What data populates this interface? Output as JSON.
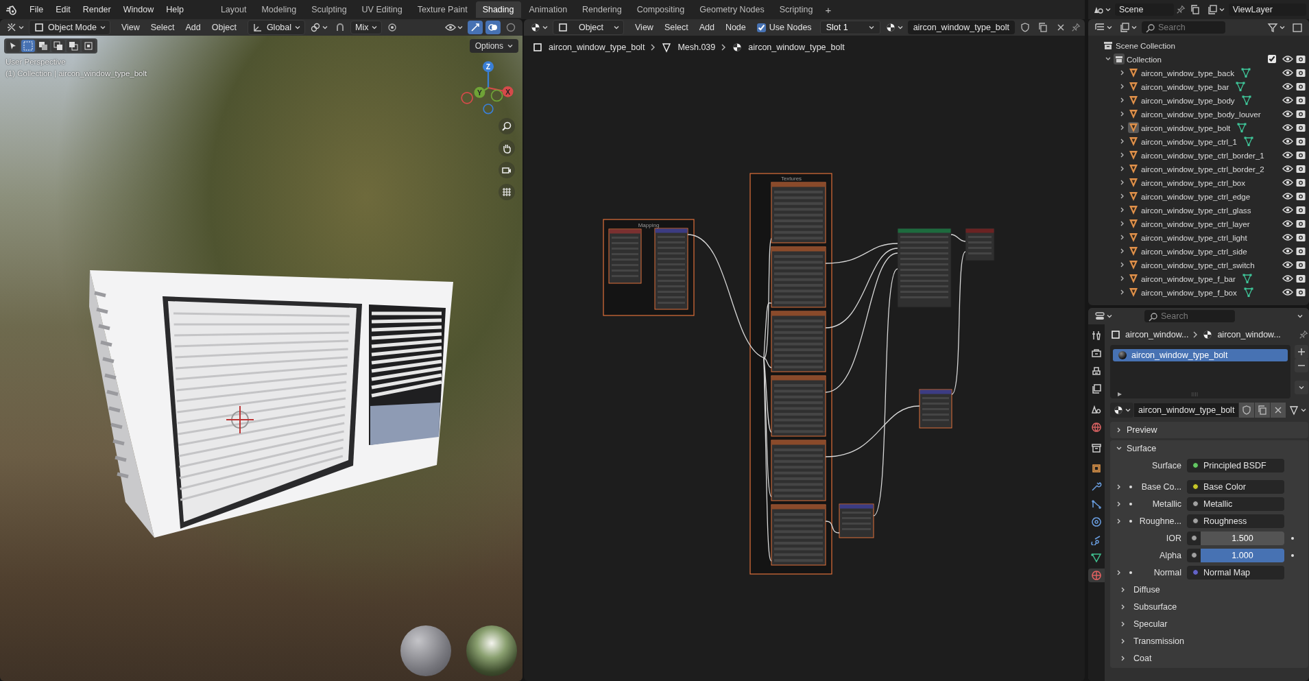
{
  "top_bar": {
    "menus": [
      "File",
      "Edit",
      "Render",
      "Window",
      "Help"
    ],
    "workspaces": [
      {
        "label": "Layout",
        "selected": false
      },
      {
        "label": "Modeling",
        "selected": false
      },
      {
        "label": "Sculpting",
        "selected": false
      },
      {
        "label": "UV Editing",
        "selected": false
      },
      {
        "label": "Texture Paint",
        "selected": false
      },
      {
        "label": "Shading",
        "selected": true
      },
      {
        "label": "Animation",
        "selected": false
      },
      {
        "label": "Rendering",
        "selected": false
      },
      {
        "label": "Compositing",
        "selected": false
      },
      {
        "label": "Geometry Nodes",
        "selected": false
      },
      {
        "label": "Scripting",
        "selected": false
      }
    ],
    "add_tab": "+"
  },
  "scene_bar": {
    "scene": "Scene",
    "view_layer": "ViewLayer"
  },
  "viewport": {
    "header": {
      "mode": "Object Mode",
      "menus": [
        "View",
        "Select",
        "Add",
        "Object"
      ],
      "orientation": "Global",
      "pivot": "Mix",
      "options": "Options"
    },
    "overlay_lines": [
      "User Perspective",
      "(1) Collection | aircon_window_type_bolt"
    ],
    "gizmo_axes": [
      "X",
      "Y",
      "Z"
    ]
  },
  "node_editor": {
    "header": {
      "object": "Object",
      "menus": [
        "View",
        "Select",
        "Add",
        "Node"
      ],
      "use_nodes": {
        "label": "Use Nodes",
        "checked": true
      },
      "slot": "Slot 1",
      "material": "aircon_window_type_bolt"
    },
    "breadcrumbs": [
      "aircon_window_type_bolt",
      "Mesh.039",
      "aircon_window_type_bolt"
    ],
    "frames": [
      "Mapping",
      "Textures"
    ]
  },
  "outliner": {
    "search": {
      "placeholder": "Search"
    },
    "scene_collection": "Scene Collection",
    "collection": {
      "label": "Collection",
      "checked": true
    },
    "items": [
      {
        "name": "aircon_window_type_back",
        "mesh_data": true,
        "active": false
      },
      {
        "name": "aircon_window_type_bar",
        "mesh_data": true,
        "active": false
      },
      {
        "name": "aircon_window_type_body",
        "mesh_data": true,
        "active": false
      },
      {
        "name": "aircon_window_type_body_louver",
        "mesh_data": false,
        "active": false
      },
      {
        "name": "aircon_window_type_bolt",
        "mesh_data": true,
        "active": true
      },
      {
        "name": "aircon_window_type_ctrl_1",
        "mesh_data": true,
        "active": false
      },
      {
        "name": "aircon_window_type_ctrl_border_1",
        "mesh_data": false,
        "active": false
      },
      {
        "name": "aircon_window_type_ctrl_border_2",
        "mesh_data": false,
        "active": false
      },
      {
        "name": "aircon_window_type_ctrl_box",
        "mesh_data": false,
        "active": false
      },
      {
        "name": "aircon_window_type_ctrl_edge",
        "mesh_data": false,
        "active": false
      },
      {
        "name": "aircon_window_type_ctrl_glass",
        "mesh_data": false,
        "active": false
      },
      {
        "name": "aircon_window_type_ctrl_layer",
        "mesh_data": false,
        "active": false
      },
      {
        "name": "aircon_window_type_ctrl_light",
        "mesh_data": false,
        "active": false
      },
      {
        "name": "aircon_window_type_ctrl_side",
        "mesh_data": false,
        "active": false
      },
      {
        "name": "aircon_window_type_ctrl_switch",
        "mesh_data": false,
        "active": false
      },
      {
        "name": "aircon_window_type_f_bar",
        "mesh_data": true,
        "active": false
      },
      {
        "name": "aircon_window_type_f_box",
        "mesh_data": true,
        "active": false
      }
    ]
  },
  "properties": {
    "search": {
      "placeholder": "Search"
    },
    "tabs": [
      {
        "kind": "tool",
        "selected": false
      },
      {
        "kind": "render",
        "selected": false
      },
      {
        "kind": "output",
        "selected": false
      },
      {
        "kind": "view_layer",
        "selected": false
      },
      {
        "kind": "scene",
        "selected": false
      },
      {
        "kind": "world",
        "selected": false
      },
      {
        "kind": "collection",
        "selected": false
      },
      {
        "kind": "object",
        "selected": false
      },
      {
        "kind": "modifier",
        "selected": false
      },
      {
        "kind": "particles",
        "selected": false
      },
      {
        "kind": "physics",
        "selected": false
      },
      {
        "kind": "constraints",
        "selected": false
      },
      {
        "kind": "data",
        "selected": false
      },
      {
        "kind": "material",
        "selected": true
      }
    ],
    "breadcrumbs": [
      "aircon_window...",
      "aircon_window..."
    ],
    "material_slots": [
      {
        "name": "aircon_window_type_bolt",
        "selected": true
      }
    ],
    "material": {
      "name": "aircon_window_type_bolt"
    },
    "panels": [
      {
        "label": "Preview",
        "expanded": false
      },
      {
        "label": "Surface",
        "expanded": true,
        "rows": [
          {
            "kind": "link",
            "label": "Surface",
            "value": "Principled BSDF",
            "color": "#63c763",
            "expandable": false
          },
          {
            "kind": "link",
            "label": "Base Co...",
            "value": "Base Color",
            "color": "#c7c729",
            "expandable": true
          },
          {
            "kind": "link",
            "label": "Metallic",
            "value": "Metallic",
            "color": "#a1a1a1",
            "expandable": true
          },
          {
            "kind": "link",
            "label": "Roughne...",
            "value": "Roughness",
            "color": "#a1a1a1",
            "expandable": true
          },
          {
            "kind": "number",
            "label": "IOR",
            "value": "1.500",
            "color": "#a1a1a1",
            "expandable": false
          },
          {
            "kind": "slider",
            "label": "Alpha",
            "value": "1.000",
            "level": 1,
            "color": "#a1a1a1",
            "expandable": false
          },
          {
            "kind": "link",
            "label": "Normal",
            "value": "Normal Map",
            "color": "#6363c7",
            "expandable": true
          }
        ],
        "subpanels": [
          {
            "label": "Diffuse",
            "expanded": false
          },
          {
            "label": "Subsurface",
            "expanded": false
          },
          {
            "label": "Specular",
            "expanded": false
          },
          {
            "label": "Transmission",
            "expanded": false
          },
          {
            "label": "Coat",
            "expanded": false
          }
        ]
      }
    ]
  }
}
